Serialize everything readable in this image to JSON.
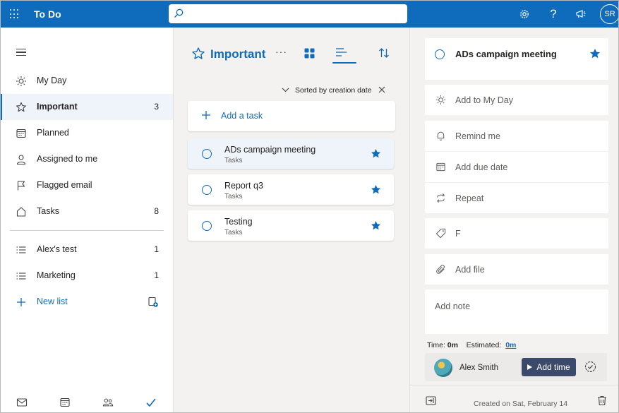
{
  "topbar": {
    "app_title": "To Do",
    "search": {
      "placeholder": "",
      "value": ""
    },
    "avatar_initials": "SR",
    "icons": [
      "waffle-icon",
      "search-icon",
      "gear-icon",
      "help-icon",
      "megaphone-icon"
    ]
  },
  "sidebar": {
    "items": [
      {
        "label": "My Day",
        "count": "",
        "icon": "sun-icon"
      },
      {
        "label": "Important",
        "count": "3",
        "icon": "star-icon"
      },
      {
        "label": "Planned",
        "count": "",
        "icon": "calendar-icon"
      },
      {
        "label": "Assigned to me",
        "count": "",
        "icon": "person-icon"
      },
      {
        "label": "Flagged email",
        "count": "",
        "icon": "flag-icon"
      },
      {
        "label": "Tasks",
        "count": "8",
        "icon": "home-icon"
      }
    ],
    "lists": [
      {
        "label": "Alex's test",
        "count": "1",
        "icon": "list-icon"
      },
      {
        "label": "Marketing",
        "count": "1",
        "icon": "list-icon"
      }
    ],
    "new_list_label": "New list"
  },
  "main": {
    "list_title": "Important",
    "sort_label": "Sorted by creation date",
    "add_task_label": "Add a task",
    "tasks": [
      {
        "title": "ADs campaign meeting",
        "list": "Tasks",
        "important": true
      },
      {
        "title": "Report q3",
        "list": "Tasks",
        "important": true
      },
      {
        "title": "Testing",
        "list": "Tasks",
        "important": true
      }
    ]
  },
  "detail": {
    "task_title": "ADs campaign meeting",
    "add_to_my_day": "Add to My Day",
    "remind_me": "Remind me",
    "add_due_date": "Add due date",
    "repeat": "Repeat",
    "category_text": "F",
    "add_file": "Add file",
    "add_note": "Add note",
    "time_label": "Time:",
    "time_value": "0m",
    "estimated_label": "Estimated:",
    "estimated_value": "0m",
    "user_name": "Alex Smith",
    "add_time_label": "Add time",
    "created_label": "Created on Sat, February 14"
  },
  "colors": {
    "accent": "#0f6cbd",
    "add_time_button": "#3b4a6b"
  }
}
